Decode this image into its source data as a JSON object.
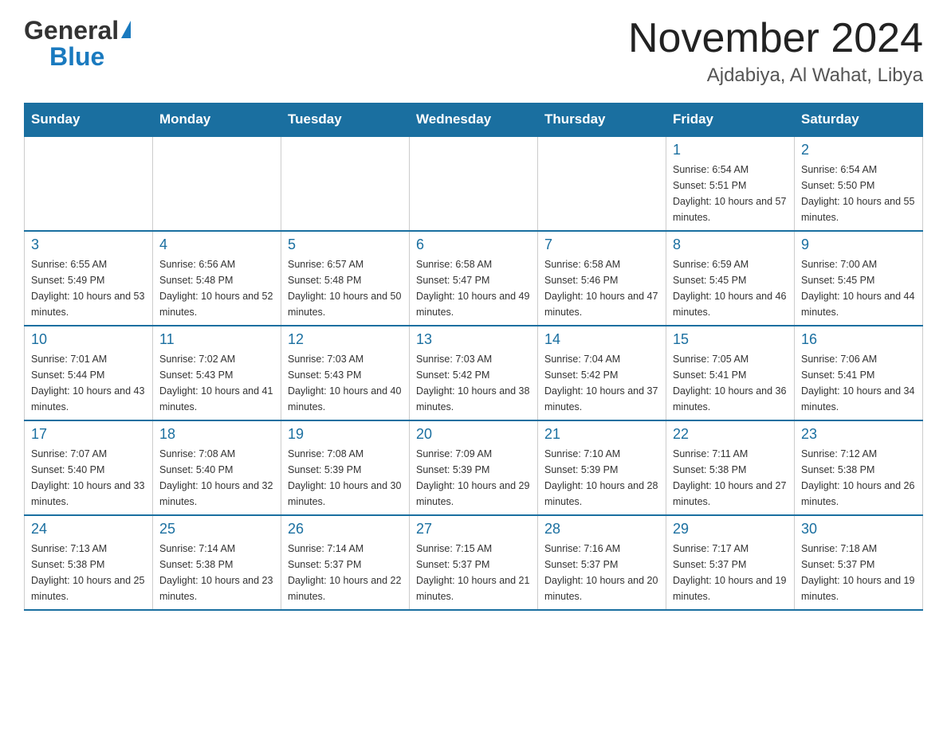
{
  "header": {
    "logo_general": "General",
    "logo_blue": "Blue",
    "month_year": "November 2024",
    "location": "Ajdabiya, Al Wahat, Libya"
  },
  "days_of_week": [
    "Sunday",
    "Monday",
    "Tuesday",
    "Wednesday",
    "Thursday",
    "Friday",
    "Saturday"
  ],
  "weeks": [
    [
      {
        "day": "",
        "info": ""
      },
      {
        "day": "",
        "info": ""
      },
      {
        "day": "",
        "info": ""
      },
      {
        "day": "",
        "info": ""
      },
      {
        "day": "",
        "info": ""
      },
      {
        "day": "1",
        "info": "Sunrise: 6:54 AM\nSunset: 5:51 PM\nDaylight: 10 hours and 57 minutes."
      },
      {
        "day": "2",
        "info": "Sunrise: 6:54 AM\nSunset: 5:50 PM\nDaylight: 10 hours and 55 minutes."
      }
    ],
    [
      {
        "day": "3",
        "info": "Sunrise: 6:55 AM\nSunset: 5:49 PM\nDaylight: 10 hours and 53 minutes."
      },
      {
        "day": "4",
        "info": "Sunrise: 6:56 AM\nSunset: 5:48 PM\nDaylight: 10 hours and 52 minutes."
      },
      {
        "day": "5",
        "info": "Sunrise: 6:57 AM\nSunset: 5:48 PM\nDaylight: 10 hours and 50 minutes."
      },
      {
        "day": "6",
        "info": "Sunrise: 6:58 AM\nSunset: 5:47 PM\nDaylight: 10 hours and 49 minutes."
      },
      {
        "day": "7",
        "info": "Sunrise: 6:58 AM\nSunset: 5:46 PM\nDaylight: 10 hours and 47 minutes."
      },
      {
        "day": "8",
        "info": "Sunrise: 6:59 AM\nSunset: 5:45 PM\nDaylight: 10 hours and 46 minutes."
      },
      {
        "day": "9",
        "info": "Sunrise: 7:00 AM\nSunset: 5:45 PM\nDaylight: 10 hours and 44 minutes."
      }
    ],
    [
      {
        "day": "10",
        "info": "Sunrise: 7:01 AM\nSunset: 5:44 PM\nDaylight: 10 hours and 43 minutes."
      },
      {
        "day": "11",
        "info": "Sunrise: 7:02 AM\nSunset: 5:43 PM\nDaylight: 10 hours and 41 minutes."
      },
      {
        "day": "12",
        "info": "Sunrise: 7:03 AM\nSunset: 5:43 PM\nDaylight: 10 hours and 40 minutes."
      },
      {
        "day": "13",
        "info": "Sunrise: 7:03 AM\nSunset: 5:42 PM\nDaylight: 10 hours and 38 minutes."
      },
      {
        "day": "14",
        "info": "Sunrise: 7:04 AM\nSunset: 5:42 PM\nDaylight: 10 hours and 37 minutes."
      },
      {
        "day": "15",
        "info": "Sunrise: 7:05 AM\nSunset: 5:41 PM\nDaylight: 10 hours and 36 minutes."
      },
      {
        "day": "16",
        "info": "Sunrise: 7:06 AM\nSunset: 5:41 PM\nDaylight: 10 hours and 34 minutes."
      }
    ],
    [
      {
        "day": "17",
        "info": "Sunrise: 7:07 AM\nSunset: 5:40 PM\nDaylight: 10 hours and 33 minutes."
      },
      {
        "day": "18",
        "info": "Sunrise: 7:08 AM\nSunset: 5:40 PM\nDaylight: 10 hours and 32 minutes."
      },
      {
        "day": "19",
        "info": "Sunrise: 7:08 AM\nSunset: 5:39 PM\nDaylight: 10 hours and 30 minutes."
      },
      {
        "day": "20",
        "info": "Sunrise: 7:09 AM\nSunset: 5:39 PM\nDaylight: 10 hours and 29 minutes."
      },
      {
        "day": "21",
        "info": "Sunrise: 7:10 AM\nSunset: 5:39 PM\nDaylight: 10 hours and 28 minutes."
      },
      {
        "day": "22",
        "info": "Sunrise: 7:11 AM\nSunset: 5:38 PM\nDaylight: 10 hours and 27 minutes."
      },
      {
        "day": "23",
        "info": "Sunrise: 7:12 AM\nSunset: 5:38 PM\nDaylight: 10 hours and 26 minutes."
      }
    ],
    [
      {
        "day": "24",
        "info": "Sunrise: 7:13 AM\nSunset: 5:38 PM\nDaylight: 10 hours and 25 minutes."
      },
      {
        "day": "25",
        "info": "Sunrise: 7:14 AM\nSunset: 5:38 PM\nDaylight: 10 hours and 23 minutes."
      },
      {
        "day": "26",
        "info": "Sunrise: 7:14 AM\nSunset: 5:37 PM\nDaylight: 10 hours and 22 minutes."
      },
      {
        "day": "27",
        "info": "Sunrise: 7:15 AM\nSunset: 5:37 PM\nDaylight: 10 hours and 21 minutes."
      },
      {
        "day": "28",
        "info": "Sunrise: 7:16 AM\nSunset: 5:37 PM\nDaylight: 10 hours and 20 minutes."
      },
      {
        "day": "29",
        "info": "Sunrise: 7:17 AM\nSunset: 5:37 PM\nDaylight: 10 hours and 19 minutes."
      },
      {
        "day": "30",
        "info": "Sunrise: 7:18 AM\nSunset: 5:37 PM\nDaylight: 10 hours and 19 minutes."
      }
    ]
  ]
}
